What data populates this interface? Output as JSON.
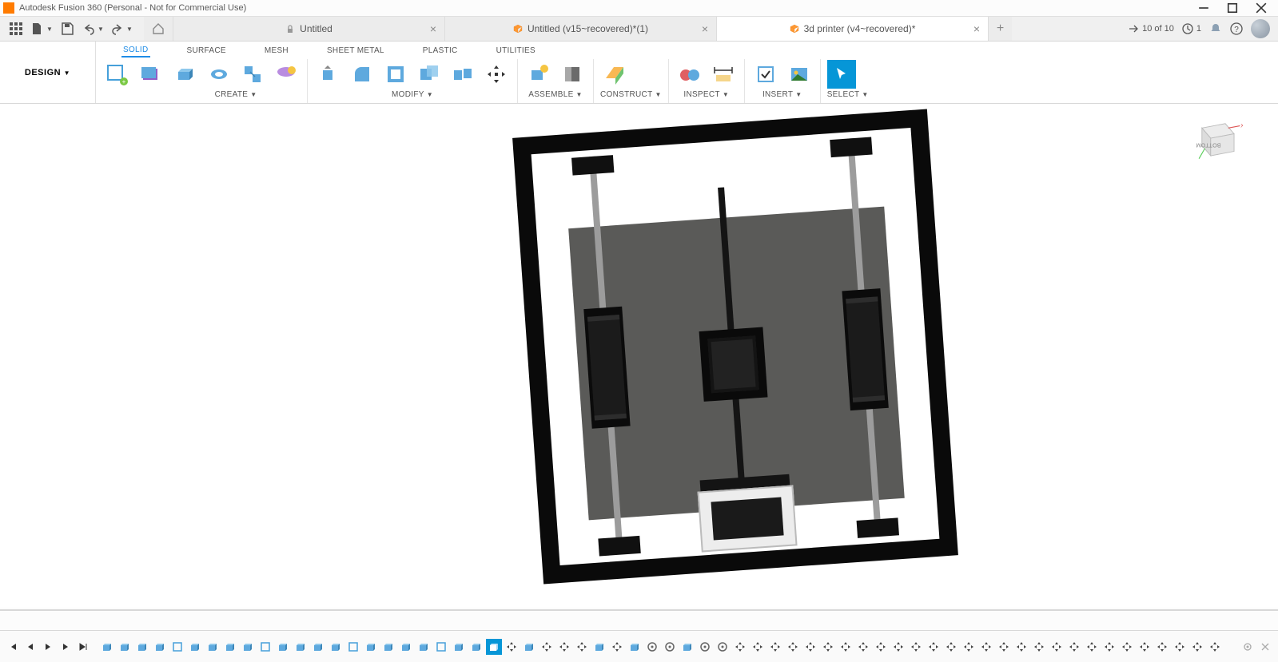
{
  "app": {
    "title": "Autodesk Fusion 360 (Personal - Not for Commercial Use)"
  },
  "tabs": [
    {
      "label": "Untitled",
      "active": false,
      "locked": true
    },
    {
      "label": "Untitled (v15~recovered)*(1)",
      "active": false,
      "locked": false
    },
    {
      "label": "3d printer (v4~recovered)*",
      "active": true,
      "locked": false
    }
  ],
  "status": {
    "jobs": "10 of 10",
    "updates": "1"
  },
  "workspace": {
    "label": "DESIGN"
  },
  "subtabs": [
    "SOLID",
    "SURFACE",
    "MESH",
    "SHEET METAL",
    "PLASTIC",
    "UTILITIES"
  ],
  "subtab_active": "SOLID",
  "ribbon_groups": {
    "create": "CREATE",
    "modify": "MODIFY",
    "assemble": "ASSEMBLE",
    "construct": "CONSTRUCT",
    "inspect": "INSPECT",
    "insert": "INSERT",
    "select": "SELECT"
  },
  "viewcube": {
    "face": "BOTTOM",
    "axis_x": "X"
  },
  "timeline": {
    "item_count": 64
  }
}
